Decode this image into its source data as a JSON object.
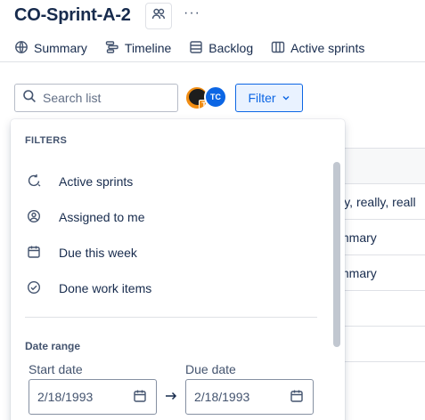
{
  "header": {
    "title": "CO-Sprint-A-2",
    "more_label": "···"
  },
  "tabs": [
    {
      "label": "Summary",
      "icon": "globe-icon"
    },
    {
      "label": "Timeline",
      "icon": "timeline-icon"
    },
    {
      "label": "Backlog",
      "icon": "backlog-icon"
    },
    {
      "label": "Active sprints",
      "icon": "board-icon"
    }
  ],
  "toolbar": {
    "search_placeholder": "Search list",
    "avatar_badge": "T",
    "avatar2_initials": "TC",
    "filter_label": "Filter"
  },
  "background_rows": [
    "",
    "lly, really, reall",
    "mmary",
    "mmary",
    "",
    "",
    ""
  ],
  "filter_panel": {
    "heading": "FILTERS",
    "options": [
      {
        "label": "Active sprints",
        "icon": "sprint-icon"
      },
      {
        "label": "Assigned to me",
        "icon": "person-icon"
      },
      {
        "label": "Due this week",
        "icon": "calendar-icon"
      },
      {
        "label": "Done work items",
        "icon": "check-circle-icon"
      }
    ],
    "date_range_heading": "Date range",
    "start_label": "Start date",
    "start_value": "2/18/1993",
    "due_label": "Due date",
    "due_value": "2/18/1993"
  },
  "colors": {
    "accent": "#0c66e4",
    "accent_bg": "#e9f2ff",
    "avatar_orange": "#f18d13"
  }
}
